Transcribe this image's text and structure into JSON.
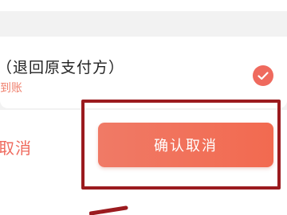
{
  "refund_option": {
    "title": "（退回原支付方）",
    "subtitle": "到账",
    "selected": true,
    "check_color": "#ef6a5e"
  },
  "actions": {
    "cancel_label": "取消",
    "confirm_label": "确认取消",
    "accent_color": "#f26a50"
  },
  "annotation": {
    "highlight_color": "#9b1b1f"
  }
}
